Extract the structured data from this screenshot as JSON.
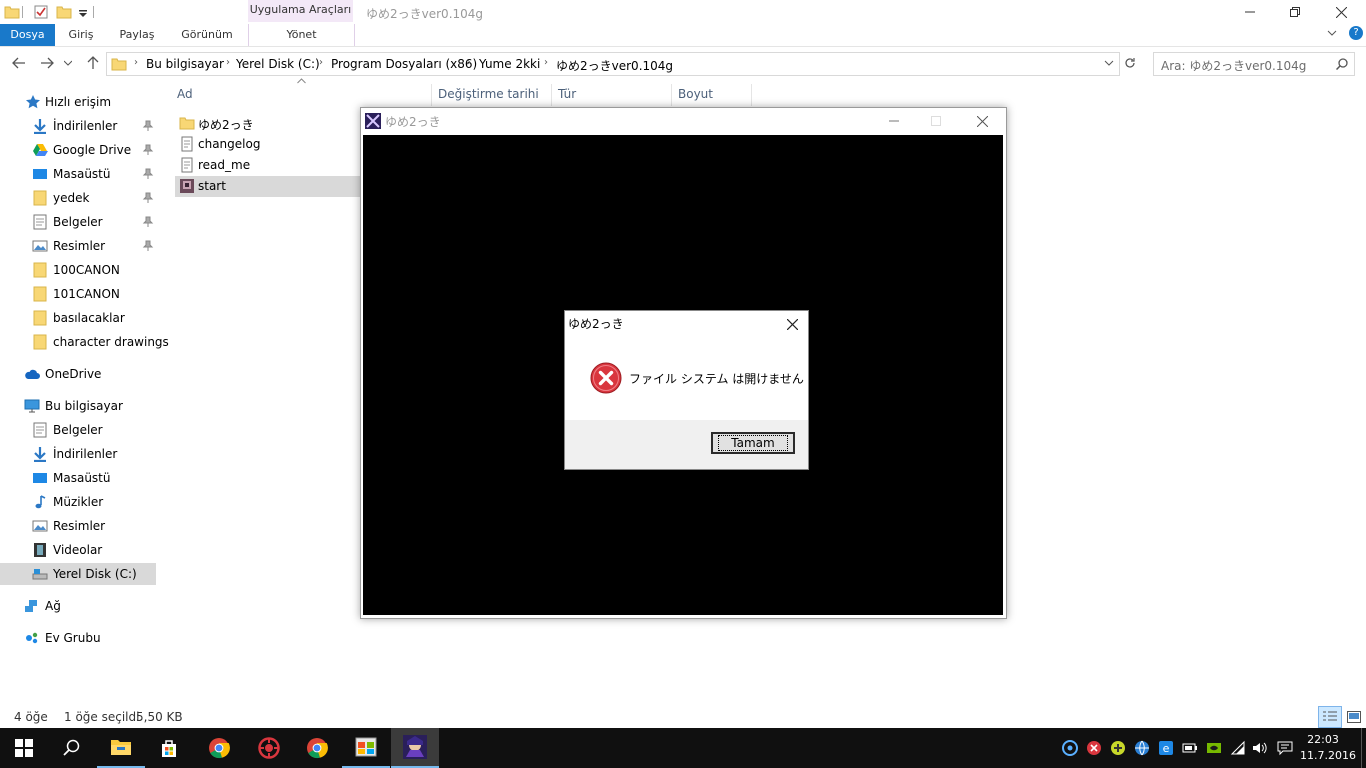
{
  "window": {
    "title": "ゆめ2っきver0.104g",
    "context_tab_group": "Uygulama Araçları"
  },
  "ribbon": {
    "tabs": [
      "Dosya",
      "Giriş",
      "Paylaş",
      "Görünüm",
      "Yönet"
    ]
  },
  "address": {
    "crumbs": [
      "Bu bilgisayar",
      "Yerel Disk (C:)",
      "Program Dosyaları (x86)",
      "Yume 2kki",
      "ゆめ2っきver0.104g"
    ],
    "search_placeholder": "Ara: ゆめ2っきver0.104g"
  },
  "nav": {
    "quick_access": "Hızlı erişim",
    "quick_items": [
      "İndirilenler",
      "Google Drive",
      "Masaüstü",
      "yedek",
      "Belgeler",
      "Resimler",
      "100CANON",
      "101CANON",
      "basılacaklar",
      "character drawings"
    ],
    "onedrive": "OneDrive",
    "this_pc": "Bu bilgisayar",
    "pc_items": [
      "Belgeler",
      "İndirilenler",
      "Masaüstü",
      "Müzikler",
      "Resimler",
      "Videolar",
      "Yerel Disk (C:)"
    ],
    "network": "Ağ",
    "homegroup": "Ev Grubu"
  },
  "columns": [
    "Ad",
    "Değiştirme tarihi",
    "Tür",
    "Boyut"
  ],
  "files": [
    "ゆめ2っき",
    "changelog",
    "read_me",
    "start"
  ],
  "status": {
    "count": "4 öğe",
    "selection": "1 öğe seçildi",
    "size": "5,50 KB"
  },
  "game_window": {
    "title": "ゆめ2っき"
  },
  "dialog": {
    "title": "ゆめ2っき",
    "message": "ファイル システム は開けません",
    "ok_label": "Tamam"
  },
  "clock": {
    "time": "22:03",
    "date": "11.7.2016"
  },
  "colors": {
    "accent": "#1979ca",
    "selection": "#d9d9d9",
    "context_tab": "#f3e8f7",
    "taskbar": "#101010",
    "error_red": "#d9363e"
  }
}
